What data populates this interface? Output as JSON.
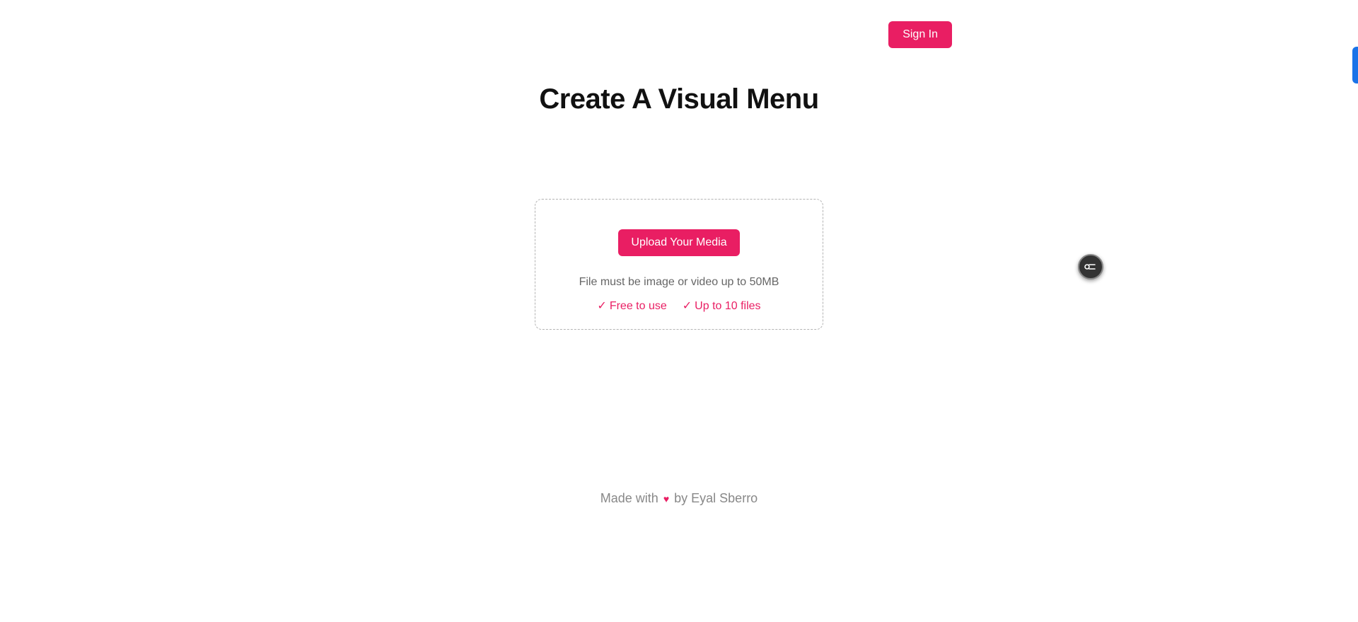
{
  "header": {
    "signin_label": "Sign In"
  },
  "main": {
    "title": "Create A Visual Menu",
    "upload_button_label": "Upload Your Media",
    "upload_hint": "File must be image or video up to 50MB",
    "features": [
      "Free to use",
      "Up to 10 files"
    ]
  },
  "footer": {
    "prefix": "Made with ",
    "heart": "♥",
    "suffix": " by Eyal Sberro"
  }
}
